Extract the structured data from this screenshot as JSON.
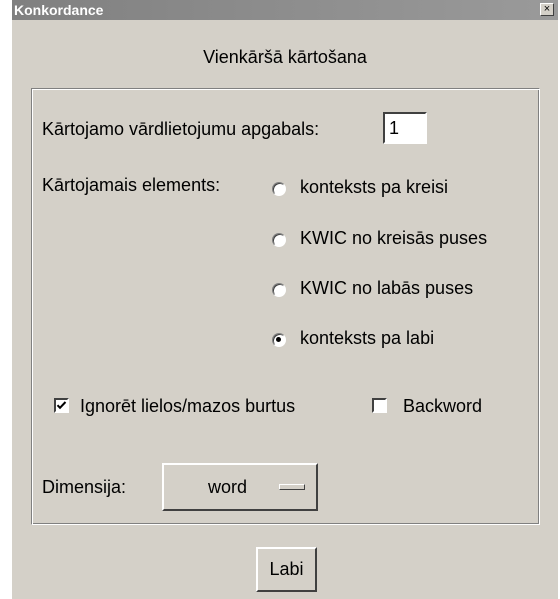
{
  "window": {
    "title": "Konkordance",
    "close_label": "×"
  },
  "dialog": {
    "heading": "Vienkāršā kārtošana"
  },
  "form": {
    "range_label": "Kārtojamo vārdlietojumu apgabals:",
    "range_value": "1",
    "element_label": "Kārtojamais elements:",
    "element_options": [
      {
        "label": "konteksts pa kreisi",
        "selected": false
      },
      {
        "label": "KWIC no kreisās puses",
        "selected": false
      },
      {
        "label": "KWIC no labās puses",
        "selected": false
      },
      {
        "label": "konteksts pa labi",
        "selected": true
      }
    ],
    "ignore_case_label": "Ignorēt lielos/mazos burtus",
    "ignore_case_checked": true,
    "backword_label": "Backword",
    "backword_checked": false,
    "dimension_label": "Dimensija:",
    "dimension_value": "word"
  },
  "buttons": {
    "ok_label": "Labi"
  }
}
